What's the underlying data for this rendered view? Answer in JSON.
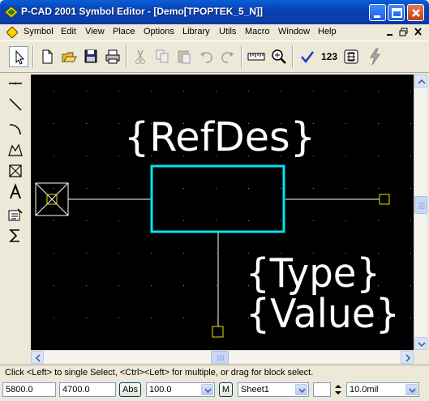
{
  "window": {
    "title": "P-CAD 2001 Symbol Editor - [Demo[TPOPTEK_5_N]]"
  },
  "menu": {
    "items": [
      "Symbol",
      "Edit",
      "View",
      "Place",
      "Options",
      "Library",
      "Utils",
      "Macro",
      "Window",
      "Help"
    ]
  },
  "toolbar": {
    "counter_label": "123"
  },
  "canvas": {
    "refdes_label": "{RefDes}",
    "type_label": "{Type}",
    "value_label": "{Value}",
    "colors": {
      "background": "#000000",
      "body": "#00e5ee",
      "text": "#ffffff",
      "pin": "#ffffff",
      "pin_marker": "#e8e000",
      "grid_dot": "#8a8a8a"
    }
  },
  "status": {
    "message": "Click <Left> to single Select, <Ctrl><Left> for multiple, or drag for block select."
  },
  "bottom": {
    "x_coord": "5800.0",
    "y_coord": "4700.0",
    "abs_label": "Abs",
    "zoom_value": "100.0",
    "m_label": "M",
    "sheet_value": "Sheet1",
    "grid_value": "10.0mil"
  }
}
